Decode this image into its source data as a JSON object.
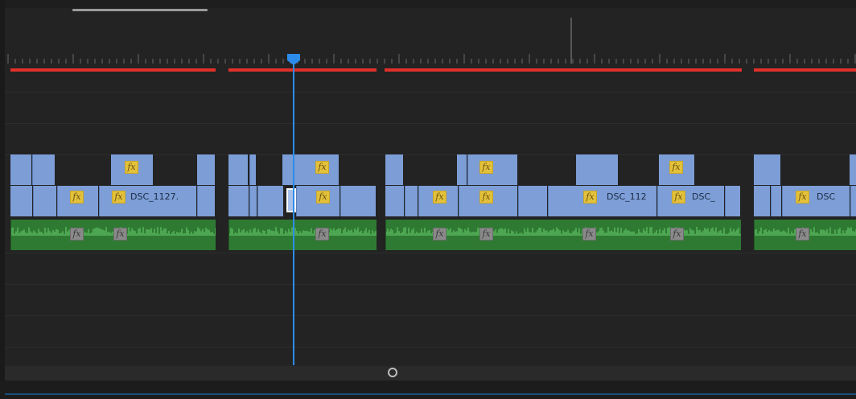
{
  "timeline": {
    "fx_label": "fx",
    "clip_names": {
      "clip1": "DSC_1127.",
      "clip2": "DSC_112",
      "clip3": "DSC_",
      "clip4": "DSC"
    }
  },
  "icons": {
    "playhead": "playhead-marker-icon",
    "fx_badge": "fx-icon",
    "zoom_handle": "circle-handle-icon"
  },
  "colors": {
    "background": "#232323",
    "video_clip": "#7d9ed6",
    "audio_clip": "#2f7a33",
    "render_bar": "#e0302a",
    "playhead": "#2d8ceb",
    "fx_badge": "#e3c13b"
  }
}
